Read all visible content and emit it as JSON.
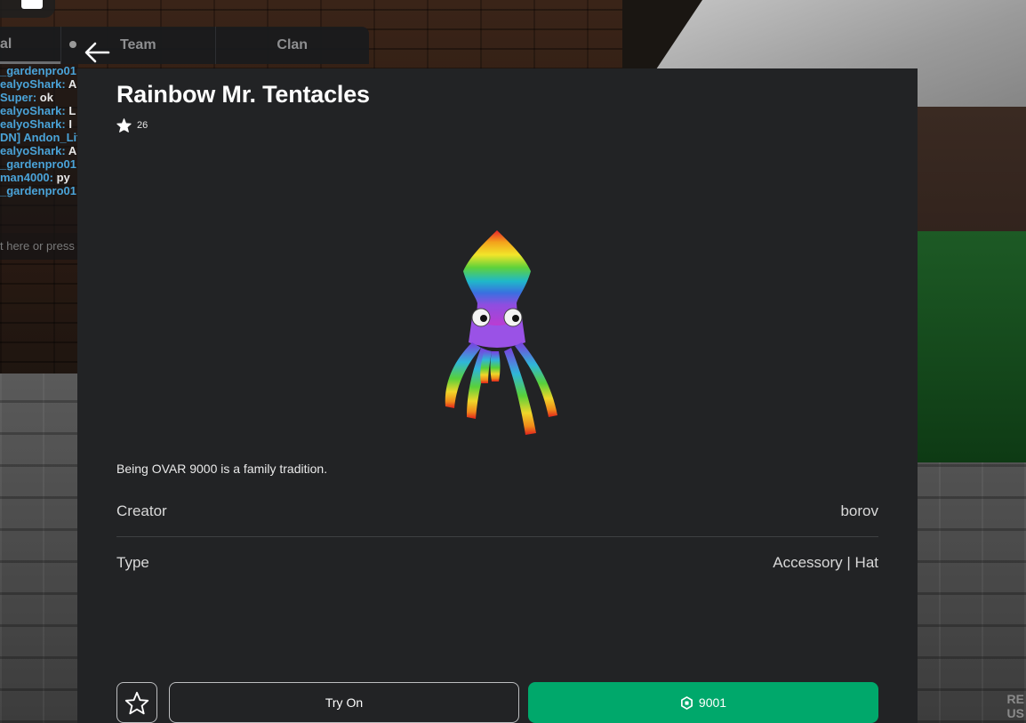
{
  "chat": {
    "tabs": [
      "al",
      "Team",
      "Clan"
    ],
    "lines": [
      {
        "name": "_gardenpro01",
        "text": ""
      },
      {
        "name": "ealyoShark:",
        "text": " A"
      },
      {
        "name": "Super:",
        "text": " ok"
      },
      {
        "name": "ealyoShark:",
        "text": " L"
      },
      {
        "name": "ealyoShark:",
        "text": " I"
      },
      {
        "name": "DN] Andon_Lit",
        "text": ""
      },
      {
        "name": "ealyoShark:",
        "text": " A"
      },
      {
        "name": "_gardenpro01",
        "text": ""
      },
      {
        "name": "man4000:",
        "text": " py"
      },
      {
        "name": "_gardenpro01",
        "text": ""
      }
    ],
    "input_placeholder": "t here or press"
  },
  "item": {
    "title": "Rainbow Mr. Tentacles",
    "favorites": "26",
    "description": "Being OVAR 9000 is a family tradition.",
    "creator_label": "Creator",
    "creator_value": "borov",
    "type_label": "Type",
    "type_value": "Accessory | Hat",
    "try_on_label": "Try On",
    "price": "9001"
  },
  "corner_text": [
    "RE",
    "US"
  ],
  "icons": {
    "back": "arrow-left-icon",
    "favorite": "star-icon",
    "currency": "robux-icon"
  },
  "colors": {
    "panel": "#222325",
    "buy": "#00a86b"
  }
}
